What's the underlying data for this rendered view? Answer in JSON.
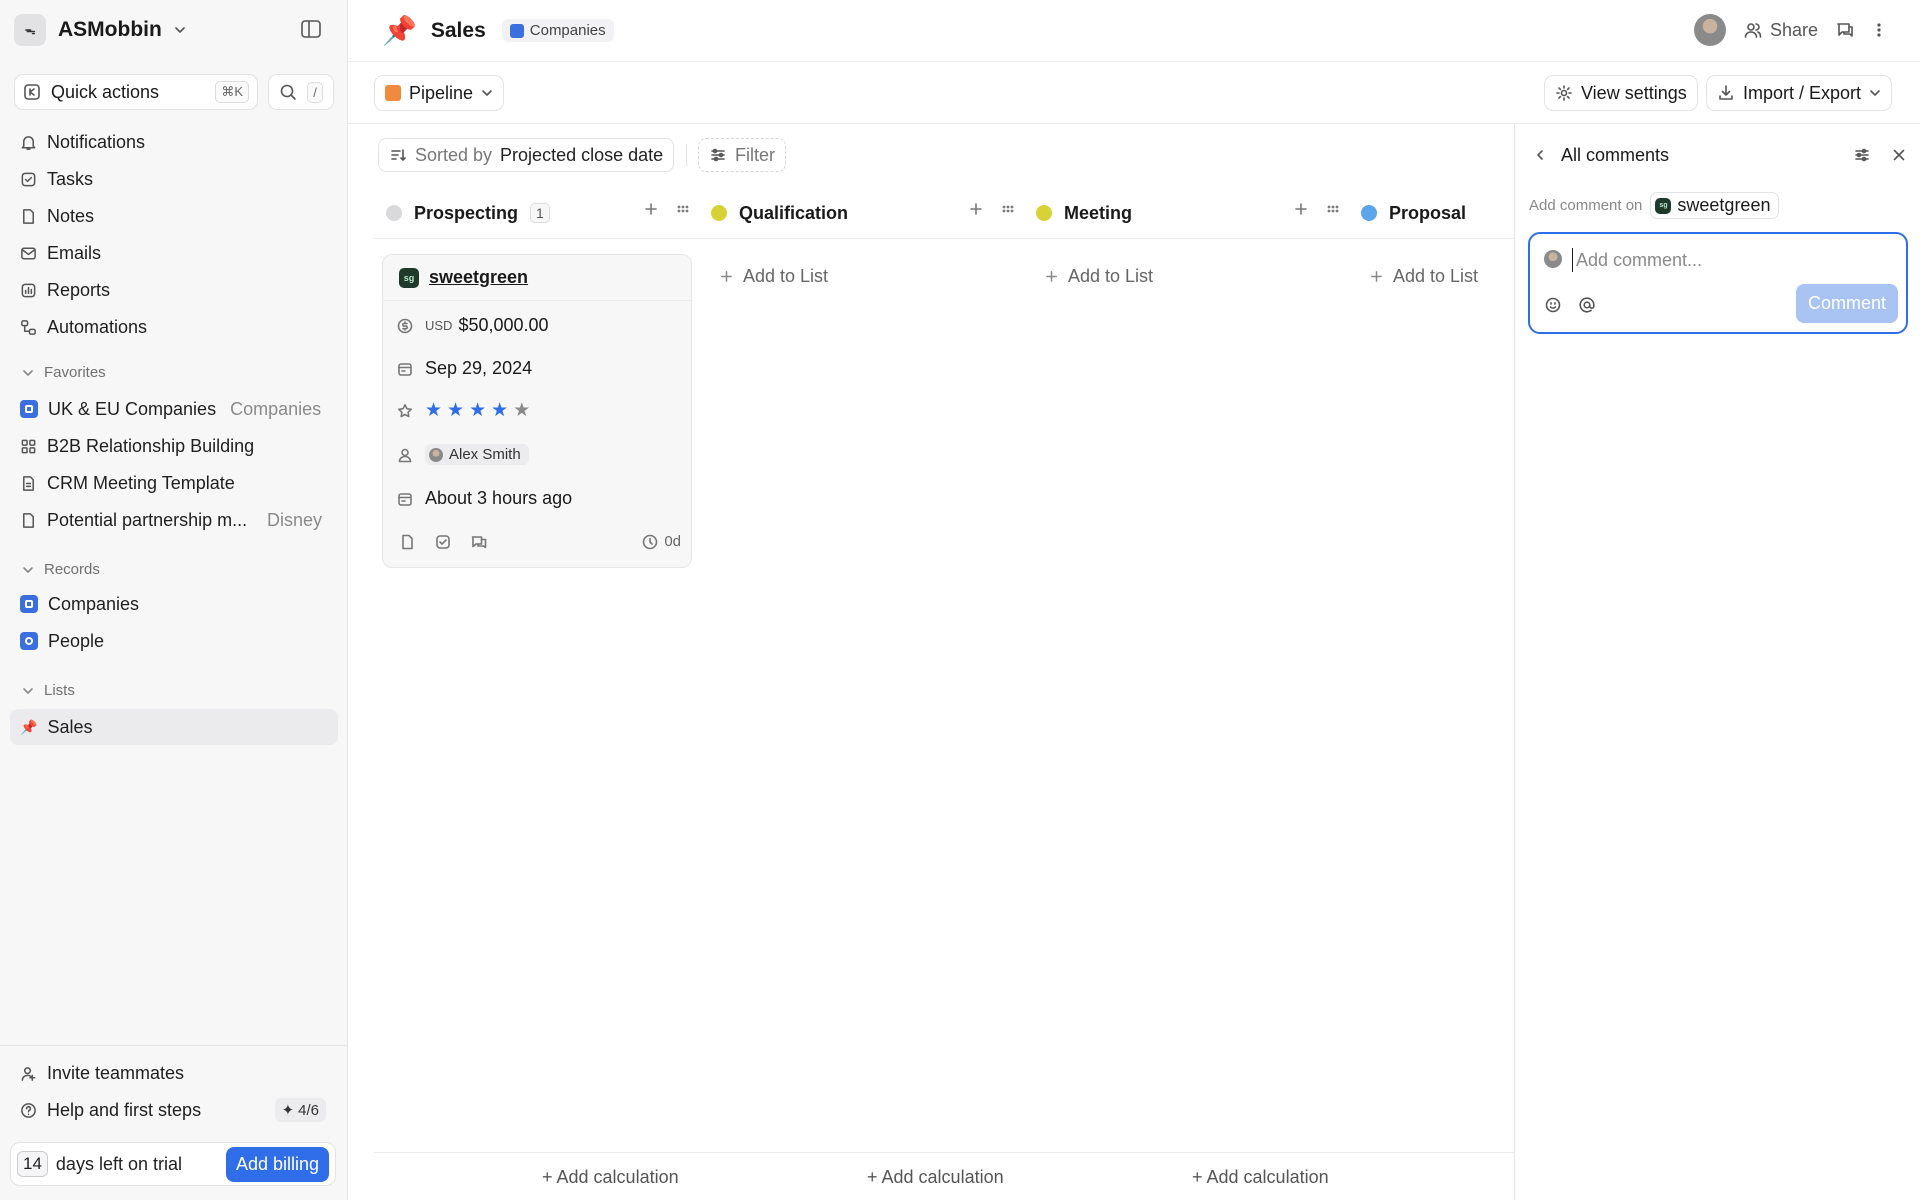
{
  "workspace": {
    "logo": "ᯓ",
    "name": "ASMobbin"
  },
  "quick_actions": {
    "label": "Quick actions",
    "shortcut": "⌘K",
    "search_shortcut": "/"
  },
  "nav": [
    {
      "label": "Notifications",
      "icon": "bell-icon"
    },
    {
      "label": "Tasks",
      "icon": "check-square-icon"
    },
    {
      "label": "Notes",
      "icon": "file-icon"
    },
    {
      "label": "Emails",
      "icon": "mail-icon"
    },
    {
      "label": "Reports",
      "icon": "chart-icon"
    },
    {
      "label": "Automations",
      "icon": "workflow-icon"
    }
  ],
  "favorites": {
    "heading": "Favorites",
    "items": [
      {
        "label": "UK & EU Companies",
        "meta": "Companies"
      },
      {
        "label": "B2B Relationship Building",
        "meta": ""
      },
      {
        "label": "CRM Meeting Template",
        "meta": ""
      },
      {
        "label": "Potential partnership m...",
        "meta": "Disney"
      }
    ]
  },
  "records": {
    "heading": "Records",
    "items": [
      {
        "label": "Companies"
      },
      {
        "label": "People"
      }
    ]
  },
  "lists": {
    "heading": "Lists",
    "items": [
      {
        "label": "Sales"
      }
    ]
  },
  "bottom": {
    "invite": "Invite teammates",
    "help": "Help and first steps",
    "progress": "4/6",
    "trial_days": "14",
    "trial_text": "days left on trial",
    "billing": "Add billing"
  },
  "header": {
    "title": "Sales",
    "object": "Companies",
    "share": "Share"
  },
  "toolbar": {
    "view": "Pipeline",
    "view_settings": "View settings",
    "import_export": "Import / Export"
  },
  "board": {
    "sort_label": "Sorted by",
    "sort_field": "Projected close date",
    "filter": "Filter",
    "columns": [
      {
        "name": "Prospecting",
        "count": "1",
        "color": "#d9d9dc"
      },
      {
        "name": "Qualification",
        "count": "",
        "color": "#d7d337"
      },
      {
        "name": "Meeting",
        "count": "",
        "color": "#d7d337"
      },
      {
        "name": "Proposal",
        "count": "",
        "color": "#5ba5ea"
      }
    ],
    "add_to_list": "Add to List",
    "add_calculation": "+ Add calculation",
    "card": {
      "logo": "sg",
      "name": "sweetgreen",
      "currency": "USD",
      "amount": "$50,000.00",
      "date": "Sep 29, 2024",
      "rating": 4,
      "rating_max": 5,
      "owner": "Alex Smith",
      "updated": "About 3 hours ago",
      "age": "0d"
    }
  },
  "comments": {
    "title": "All comments",
    "add_on": "Add comment on",
    "record": "sweetgreen",
    "placeholder": "Add comment...",
    "button": "Comment"
  },
  "colors": {
    "accent": "#2f6ee8",
    "star_on": "#2f6ee8",
    "star_off": "#8a8a8a"
  }
}
